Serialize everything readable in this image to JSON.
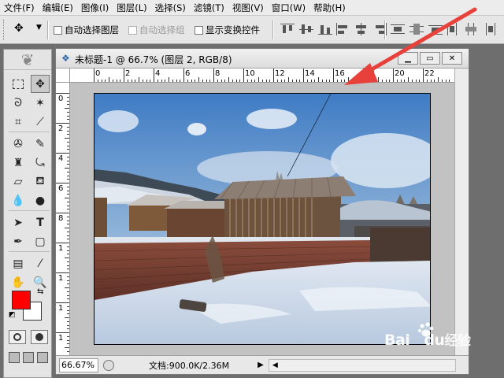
{
  "menu": [
    "文件(F)",
    "编辑(E)",
    "图像(I)",
    "图层(L)",
    "选择(S)",
    "滤镜(T)",
    "视图(V)",
    "窗口(W)",
    "帮助(H)"
  ],
  "options": {
    "auto_select_layer": "自动选择图层",
    "auto_select_group": "自动选择组",
    "show_transform": "显示变换控件"
  },
  "document": {
    "title": "未标题-1 @ 66.7% (图层 2, RGB/8)",
    "zoom": "66.67%",
    "doc_info": "文档:900.0K/2.36M"
  },
  "ruler": {
    "h_labels": [
      "0",
      "2",
      "4",
      "6",
      "8",
      "10",
      "12",
      "14",
      "16",
      "18",
      "20",
      "22"
    ],
    "v_labels": [
      "0",
      "2",
      "4",
      "6",
      "8",
      "1",
      "1",
      "1",
      "1"
    ]
  },
  "watermark": {
    "brand": "Bai",
    "brand2": "du",
    "suffix": "经验"
  },
  "colors": {
    "foreground": "#ff0000",
    "background": "#ffffff",
    "arrow": "#e8413b"
  },
  "icons": [
    "move-tool-icon",
    "marquee-icon",
    "lasso-icon",
    "magic-wand-icon",
    "crop-icon",
    "eyedropper-icon",
    "healing-icon",
    "brush-icon",
    "stamp-icon",
    "history-brush-icon",
    "eraser-icon",
    "bucket-icon",
    "blur-icon",
    "dodge-icon",
    "path-select-icon",
    "type-icon",
    "pen-icon",
    "shape-icon",
    "notes-icon",
    "hand-icon",
    "zoom-icon"
  ]
}
